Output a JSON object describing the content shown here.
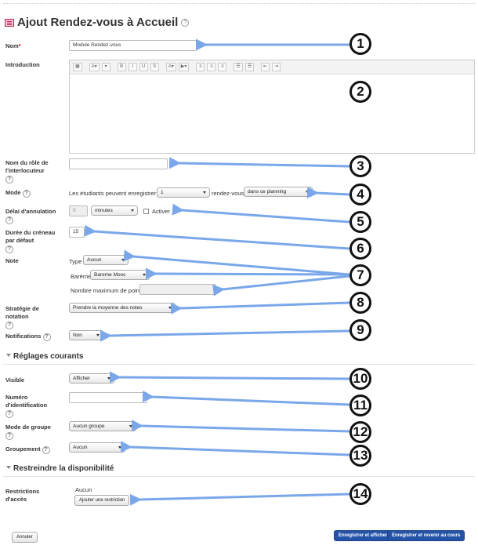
{
  "page": {
    "title": "Ajout Rendez-vous à Accueil"
  },
  "fields": {
    "nom": {
      "label": "Nom",
      "required_mark": "*",
      "value": "Module Rendez-vous"
    },
    "introduction": {
      "label": "Introduction"
    },
    "role": {
      "label_line1": "Nom du rôle de",
      "label_line2": "l'interlocuteur",
      "value": ""
    },
    "mode": {
      "label": "Mode",
      "text_before": "Les étudiants peuvent enregistrer",
      "count": "1",
      "text_middle": "rendez-vous",
      "scope": "dans ce planning"
    },
    "delai": {
      "label": "Délai d'annulation",
      "value": "0",
      "unit": "minutes",
      "activer": "Activer"
    },
    "duree": {
      "label_line1": "Durée du créneau",
      "label_line2": "par défaut",
      "value": "15"
    },
    "note": {
      "label": "Note",
      "type_label": "Type",
      "type_value": "Aucun",
      "bareme_label": "Barème",
      "bareme_value": "Bareme Mooc",
      "max_label": "Nombre maximum de points",
      "max_value": ""
    },
    "strategie": {
      "label_line1": "Stratégie de",
      "label_line2": "notation",
      "value": "Prendre la moyenne des notes"
    },
    "notifications": {
      "label": "Notifications",
      "value": "Non"
    }
  },
  "sections": {
    "reglages": "Réglages courants",
    "restreindre": "Restreindre la disponibilité"
  },
  "reglages": {
    "visible": {
      "label": "Visible",
      "value": "Afficher"
    },
    "numero": {
      "label_line1": "Numéro",
      "label_line2": "d'identification",
      "value": ""
    },
    "groupe": {
      "label": "Mode de groupe",
      "value": "Aucun groupe"
    },
    "groupement": {
      "label": "Groupement",
      "value": "Aucun"
    }
  },
  "restrictions": {
    "label_line1": "Restrictions",
    "label_line2": "d'accès",
    "status": "Aucun",
    "add_button": "Ajouter une restriction"
  },
  "buttons": {
    "cancel": "Annuler",
    "save_show": "Enregistrer et afficher",
    "save_return": "Enregistrer et revenir au cours"
  },
  "editor_toolbar": [
    "▦",
    "A▾",
    "▾",
    "B",
    "I",
    "U",
    "S",
    "A▾",
    "▶▾",
    "≡",
    "≡",
    "≡",
    "☰",
    "☰",
    "⇤",
    "⇥"
  ],
  "markers": [
    "1",
    "2",
    "3",
    "4",
    "5",
    "6",
    "7",
    "8",
    "9",
    "10",
    "11",
    "12",
    "13",
    "14"
  ],
  "colors": {
    "arrow": "#7aa7ea",
    "primary_button": "#2453a8",
    "required": "#cc0000"
  }
}
